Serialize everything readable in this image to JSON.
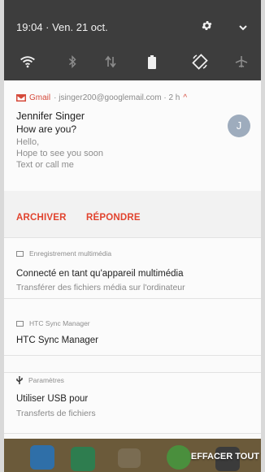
{
  "status_bar": {
    "datetime": "19:04 · Ven. 21 oct."
  },
  "quick_settings": [
    {
      "icon": "wifi-icon"
    },
    {
      "icon": "bluetooth-icon"
    },
    {
      "icon": "data-transfer-icon"
    },
    {
      "icon": "battery-icon"
    },
    {
      "icon": "auto-rotate-icon"
    },
    {
      "icon": "airplane-mode-icon"
    }
  ],
  "gmail": {
    "app": "Gmail",
    "account": "· jsinger200@googlemail.com · 2 h",
    "sender": "Jennifer Singer",
    "subject": "How are you?",
    "lines": [
      "Hello,",
      "Hope to see you soon",
      "Text or call me"
    ],
    "avatar_letter": "J",
    "avatar_color": "#9eacbd",
    "action_archive": "ARCHIVER",
    "action_reply": "RÉPONDRE",
    "action_color": "#e1432e"
  },
  "media_notification": {
    "app": "Enregistrement multimédia",
    "title": "Connecté en tant qu'appareil multimédia",
    "text": "Transférer des fichiers média sur l'ordinateur"
  },
  "sync_notification": {
    "app": "HTC Sync Manager",
    "title": "HTC Sync Manager"
  },
  "usb_notification": {
    "app": "Paramètres",
    "title": "Utiliser USB pour",
    "text": "Transferts de fichiers"
  },
  "clear_all": "EFFACER TOUT"
}
